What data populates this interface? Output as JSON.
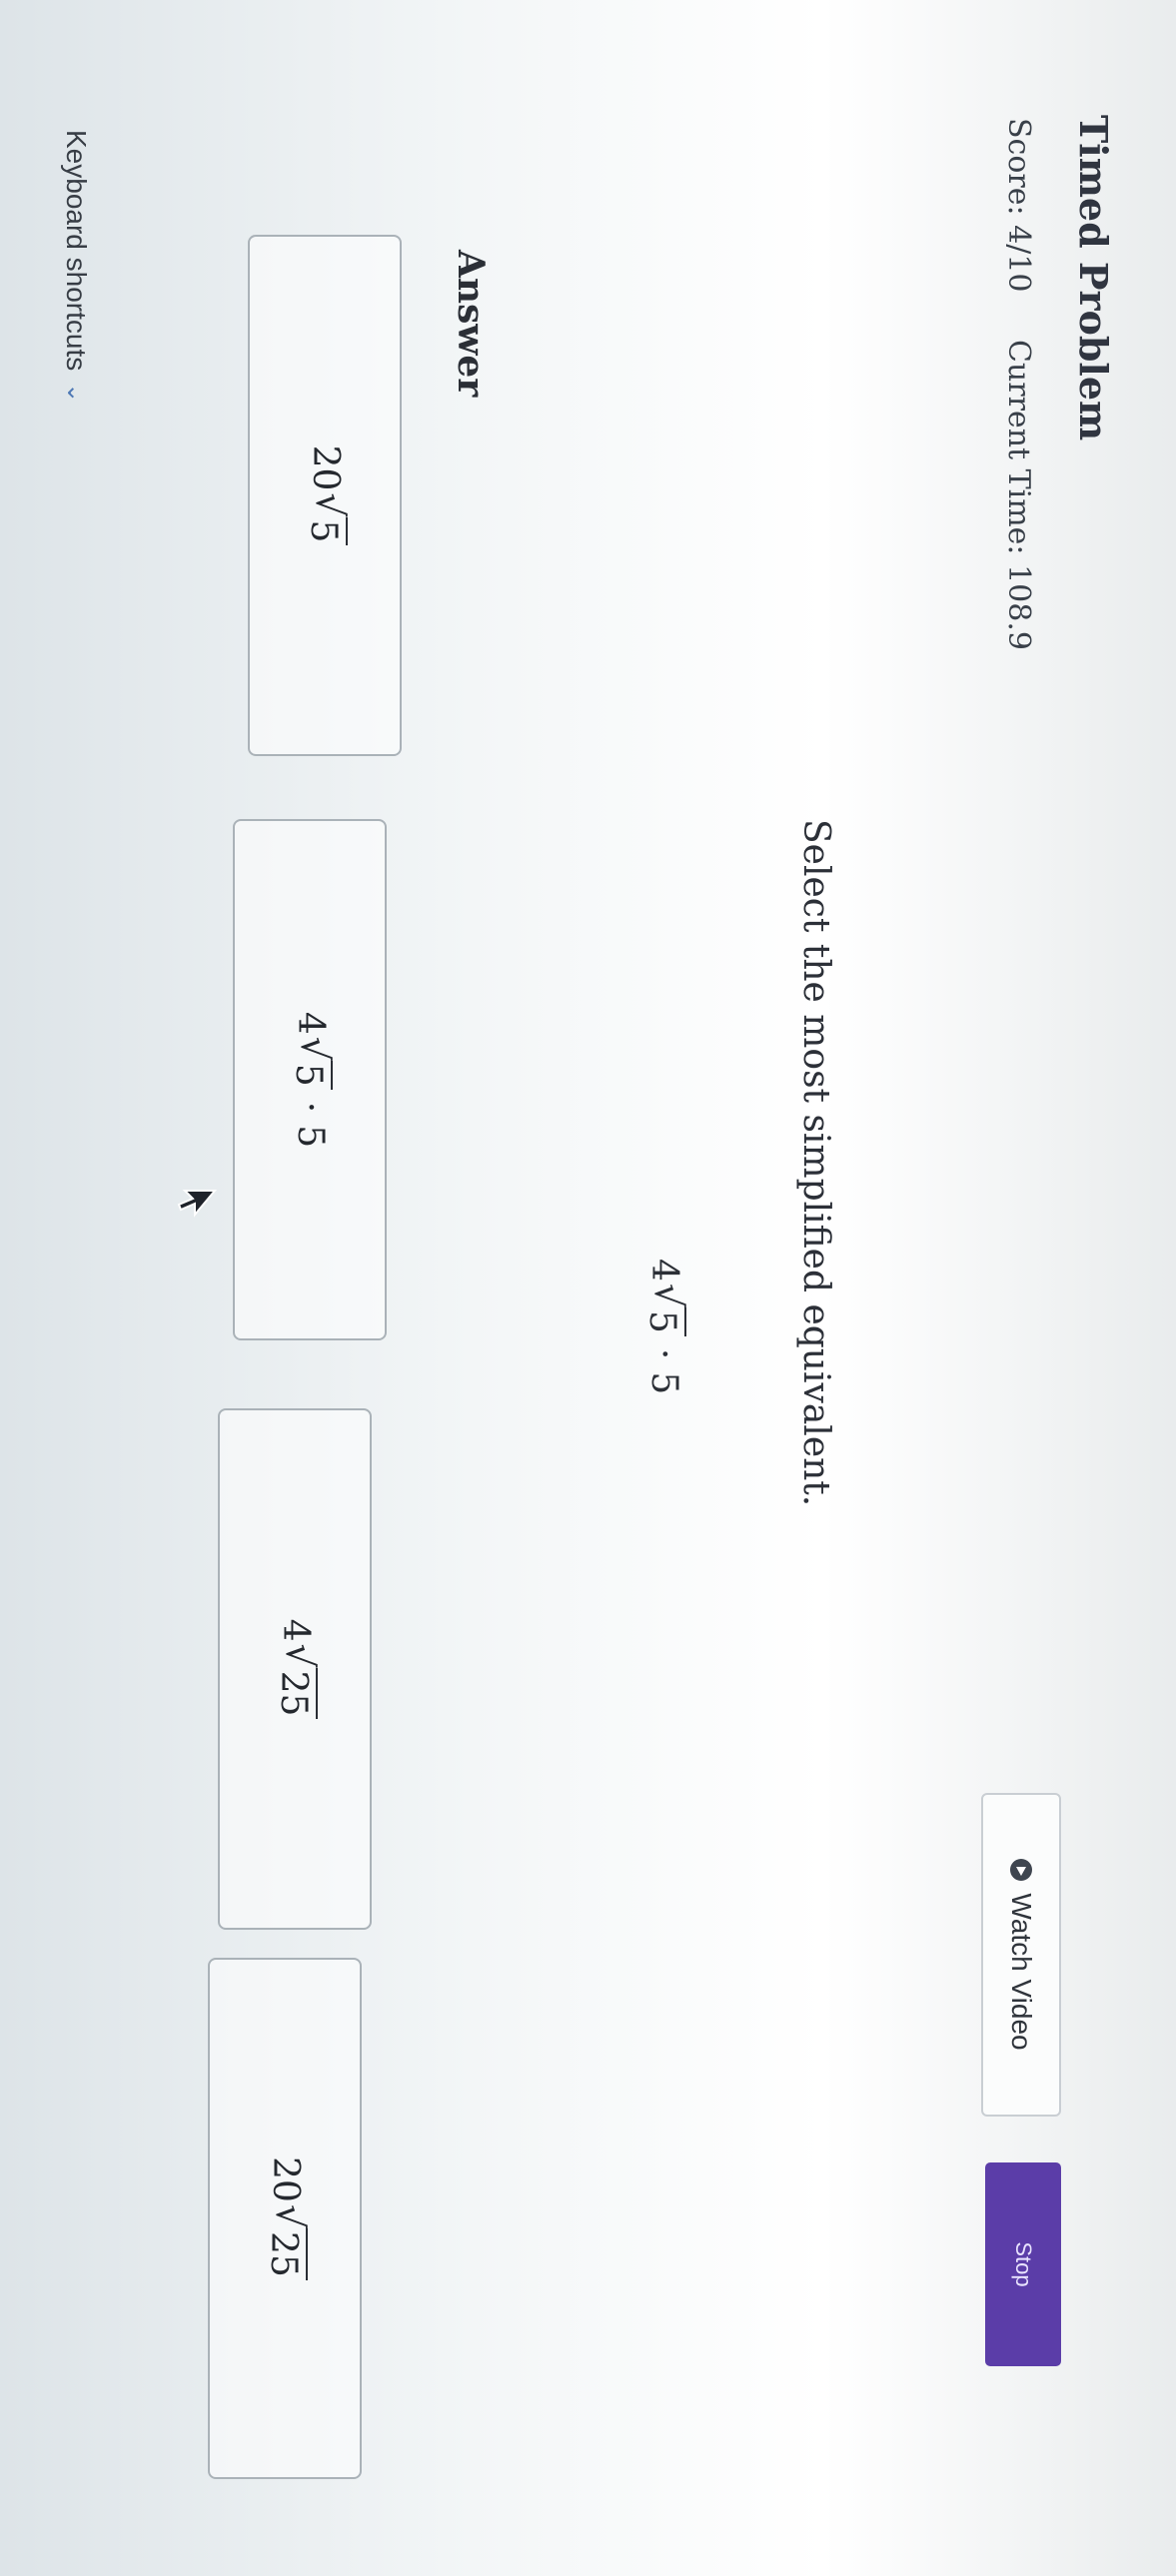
{
  "header": {
    "title": "Timed Problem",
    "score": "Score: 4/10",
    "current_time": "Current Time: 108.9",
    "watch_video_label": "Watch Video",
    "stop_label": "Stop"
  },
  "question": {
    "prompt": "Select the most simplified equivalent.",
    "expression": {
      "coefficient": "4",
      "radicand": "5",
      "operator": "·",
      "factor": "5"
    }
  },
  "answer": {
    "label": "Answer",
    "choices": [
      {
        "coefficient": "20",
        "radicand": "5",
        "operator": "",
        "factor": ""
      },
      {
        "coefficient": "4",
        "radicand": "5",
        "operator": "·",
        "factor": "5"
      },
      {
        "coefficient": "4",
        "radicand": "25",
        "operator": "",
        "factor": ""
      },
      {
        "coefficient": "20",
        "radicand": "25",
        "operator": "",
        "factor": ""
      }
    ]
  },
  "footer": {
    "keyboard_shortcuts": "Keyboard shortcuts"
  },
  "colors": {
    "stop_button": "#5b3da8",
    "chevron": "#4f79b5"
  }
}
